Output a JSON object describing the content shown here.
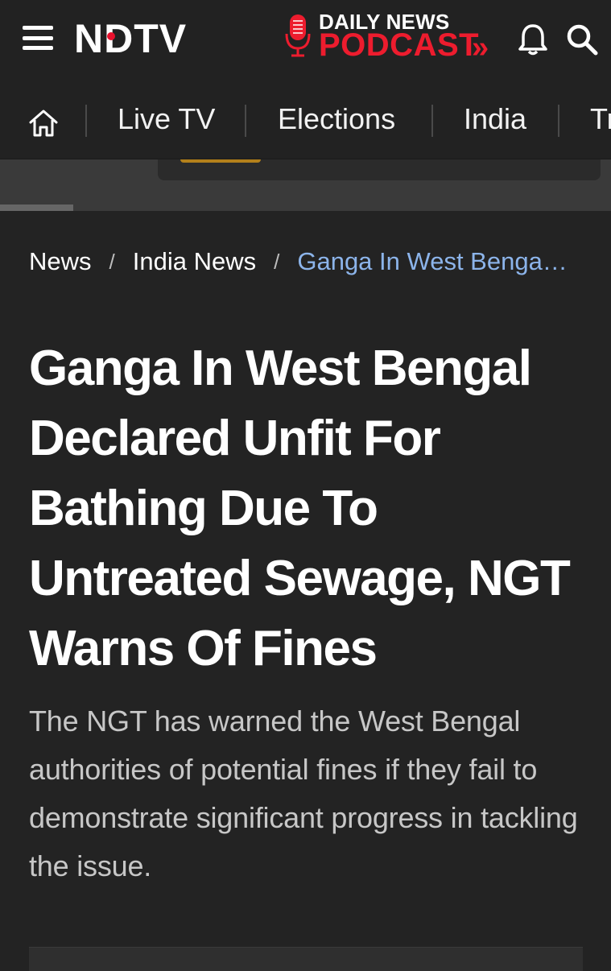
{
  "header": {
    "logo_text": "NDTV",
    "podcast_line1": "DAILY NEWS",
    "podcast_line2": "PODCAST",
    "podcast_chevron": "»",
    "icons": {
      "menu": "hamburger-menu-icon",
      "mic": "microphone-icon",
      "bell": "bell-icon",
      "search": "search-icon"
    },
    "colors": {
      "brand_red": "#ed1c2e",
      "background": "#222222"
    }
  },
  "nav": {
    "home_icon": "home-icon",
    "items": [
      {
        "label": "Live TV"
      },
      {
        "label": "Elections"
      },
      {
        "label": "India"
      },
      {
        "label": "Tr"
      }
    ]
  },
  "breadcrumb": {
    "items": [
      "News",
      "India News"
    ],
    "separator": "/",
    "current": "Ganga In West Benga…",
    "current_color": "#8cb4ea"
  },
  "article": {
    "headline": "Ganga In West Bengal Declared Unfit For Bathing Due To Untreated Sewage, NGT Warns Of Fines",
    "summary": "The NGT has warned the West Bengal authorities of potential fines if they fail to demonstrate significant progress in tackling the issue."
  },
  "scroll_progress": 0.12
}
